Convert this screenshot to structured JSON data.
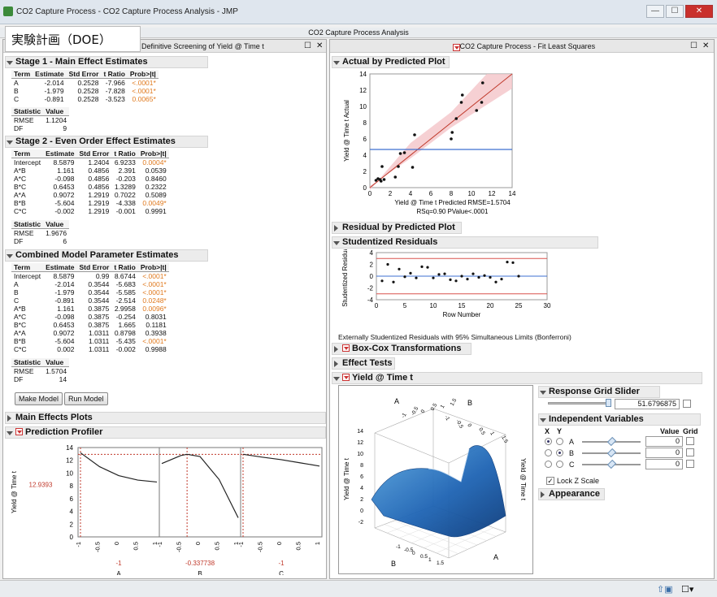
{
  "window": {
    "title": "CO2 Capture Process - CO2 Capture Process Analysis - JMP",
    "min": "—",
    "max": "☐",
    "close": "✕"
  },
  "overlay_label": "実験計画（DOE）",
  "report_title": "CO2 Capture Process Analysis",
  "left_tab": "Definitive Screening of Yield @ Time t",
  "right_tab": "CO2 Capture Process - Fit Least Squares",
  "stage1": {
    "title": "Stage 1 - Main Effect Estimates",
    "cols": [
      "Term",
      "Estimate",
      "Std Error",
      "t Ratio",
      "Prob>|t|"
    ],
    "rows": [
      [
        "A",
        "-2.014",
        "0.2528",
        "-7.966",
        "<.0001*"
      ],
      [
        "B",
        "-1.979",
        "0.2528",
        "-7.828",
        "<.0001*"
      ],
      [
        "C",
        "-0.891",
        "0.2528",
        "-3.523",
        "0.0065*"
      ]
    ],
    "stat_cols": [
      "Statistic",
      "Value"
    ],
    "stats": [
      [
        "RMSE",
        "1.1204"
      ],
      [
        "DF",
        "9"
      ]
    ]
  },
  "stage2": {
    "title": "Stage 2 - Even Order Effect Estimates",
    "cols": [
      "Term",
      "Estimate",
      "Std Error",
      "t Ratio",
      "Prob>|t|"
    ],
    "rows": [
      [
        "Intercept",
        "8.5879",
        "1.2404",
        "6.9233",
        "0.0004*"
      ],
      [
        "A*B",
        "1.161",
        "0.4856",
        "2.391",
        "0.0539"
      ],
      [
        "A*C",
        "-0.098",
        "0.4856",
        "-0.203",
        "0.8460"
      ],
      [
        "B*C",
        "0.6453",
        "0.4856",
        "1.3289",
        "0.2322"
      ],
      [
        "A*A",
        "0.9072",
        "1.2919",
        "0.7022",
        "0.5089"
      ],
      [
        "B*B",
        "-5.604",
        "1.2919",
        "-4.338",
        "0.0049*"
      ],
      [
        "C*C",
        "-0.002",
        "1.2919",
        "-0.001",
        "0.9991"
      ]
    ],
    "stat_cols": [
      "Statistic",
      "Value"
    ],
    "stats": [
      [
        "RMSE",
        "1.9676"
      ],
      [
        "DF",
        "6"
      ]
    ]
  },
  "combined": {
    "title": "Combined Model Parameter Estimates",
    "cols": [
      "Term",
      "Estimate",
      "Std Error",
      "t Ratio",
      "Prob>|t|"
    ],
    "rows": [
      [
        "Intercept",
        "8.5879",
        "0.99",
        "8.6744",
        "<.0001*"
      ],
      [
        "A",
        "-2.014",
        "0.3544",
        "-5.683",
        "<.0001*"
      ],
      [
        "B",
        "-1.979",
        "0.3544",
        "-5.585",
        "<.0001*"
      ],
      [
        "C",
        "-0.891",
        "0.3544",
        "-2.514",
        "0.0248*"
      ],
      [
        "A*B",
        "1.161",
        "0.3875",
        "2.9958",
        "0.0096*"
      ],
      [
        "A*C",
        "-0.098",
        "0.3875",
        "-0.254",
        "0.8031"
      ],
      [
        "B*C",
        "0.6453",
        "0.3875",
        "1.665",
        "0.1181"
      ],
      [
        "A*A",
        "0.9072",
        "1.0311",
        "0.8798",
        "0.3938"
      ],
      [
        "B*B",
        "-5.604",
        "1.0311",
        "-5.435",
        "<.0001*"
      ],
      [
        "C*C",
        "0.002",
        "1.0311",
        "-0.002",
        "0.9988"
      ]
    ],
    "stat_cols": [
      "Statistic",
      "Value"
    ],
    "stats": [
      [
        "RMSE",
        "1.5704"
      ],
      [
        "DF",
        "14"
      ]
    ]
  },
  "buttons": {
    "make_model": "Make Model",
    "run_model": "Run Model"
  },
  "main_effects_title": "Main Effects Plots",
  "profiler": {
    "title": "Prediction Profiler",
    "ylabel": "Yield @ Time t",
    "current_y": "12.9393",
    "yticks": [
      "14",
      "12",
      "10",
      "8",
      "6",
      "4",
      "2",
      "0"
    ],
    "xticks": [
      "-1",
      "-0.5",
      "0",
      "0.5",
      "1"
    ],
    "factors": [
      {
        "name": "A",
        "value": "-1",
        "level": -1
      },
      {
        "name": "B",
        "value": "-0.337738",
        "level": -0.337738
      },
      {
        "name": "C",
        "value": "-1",
        "level": -1
      }
    ],
    "curves": {
      "A": [
        [
          -1,
          13.18
        ],
        [
          -0.5,
          11.0
        ],
        [
          0,
          9.6
        ],
        [
          0.5,
          8.9
        ],
        [
          1,
          8.6
        ]
      ],
      "B": [
        [
          -1,
          11.5
        ],
        [
          -0.5,
          12.75
        ],
        [
          -0.337738,
          12.94
        ],
        [
          0,
          12.6
        ],
        [
          0.5,
          9.0
        ],
        [
          1,
          3.0
        ]
      ],
      "C": [
        [
          -1,
          12.94
        ],
        [
          -0.5,
          12.5
        ],
        [
          0,
          12.1
        ],
        [
          0.5,
          11.6
        ],
        [
          1,
          11.1
        ]
      ]
    }
  },
  "avp": {
    "title": "Actual by Predicted Plot",
    "ylabel": "Yield @ Time t Actual",
    "xlabel": "Yield @ Time t Predicted RMSE=1.5704",
    "stats": "RSq=0.90 PValue<.0001",
    "ticks": [
      "0",
      "2",
      "4",
      "6",
      "8",
      "10",
      "12",
      "14"
    ],
    "mean_y": 4.7,
    "chart_data": {
      "type": "scatter",
      "xlim": [
        0,
        14
      ],
      "ylim": [
        0,
        14
      ],
      "points": [
        [
          0.6,
          0.9
        ],
        [
          0.8,
          1.1
        ],
        [
          1.0,
          1.0
        ],
        [
          1.1,
          0.8
        ],
        [
          1.2,
          2.6
        ],
        [
          1.4,
          1.0
        ],
        [
          2.5,
          1.3
        ],
        [
          2.8,
          2.6
        ],
        [
          3.0,
          4.2
        ],
        [
          3.4,
          4.3
        ],
        [
          4.2,
          2.5
        ],
        [
          4.4,
          6.5
        ],
        [
          8.0,
          6.0
        ],
        [
          8.1,
          6.8
        ],
        [
          8.5,
          8.5
        ],
        [
          9.0,
          10.5
        ],
        [
          9.1,
          11.4
        ],
        [
          10.5,
          9.5
        ],
        [
          11.0,
          10.5
        ],
        [
          11.1,
          12.9
        ]
      ]
    }
  },
  "residual_pred_title": "Residual by Predicted Plot",
  "stud": {
    "title": "Studentized Residuals",
    "ylabel": "Studentized Residual",
    "xlabel": "Row Number",
    "yticks": [
      "4",
      "2",
      "0",
      "-2",
      "-4"
    ],
    "xticks": [
      "0",
      "5",
      "10",
      "15",
      "20",
      "25",
      "30"
    ],
    "note": "Externally Studentized Residuals with 95% Simultaneous Limits (Bonferroni)",
    "chart_data": {
      "type": "scatter",
      "xlim": [
        0,
        30
      ],
      "ylim": [
        -4,
        4
      ],
      "limit": 3.0,
      "points": [
        [
          1,
          -0.8
        ],
        [
          2,
          2.0
        ],
        [
          3,
          -1.0
        ],
        [
          4,
          1.2
        ],
        [
          5,
          -0.1
        ],
        [
          6,
          0.5
        ],
        [
          7,
          -0.3
        ],
        [
          8,
          1.6
        ],
        [
          9,
          1.5
        ],
        [
          10,
          -0.3
        ],
        [
          11,
          0.3
        ],
        [
          12,
          0.4
        ],
        [
          13,
          -0.6
        ],
        [
          14,
          -0.8
        ],
        [
          15,
          0.0
        ],
        [
          16,
          -0.5
        ],
        [
          17,
          0.4
        ],
        [
          18,
          -0.2
        ],
        [
          19,
          0.1
        ],
        [
          20,
          -0.2
        ],
        [
          21,
          -1.0
        ],
        [
          22,
          -0.5
        ],
        [
          23,
          2.4
        ],
        [
          24,
          2.3
        ],
        [
          25,
          0.0
        ]
      ]
    }
  },
  "boxcox_title": "Box-Cox Transformations",
  "effect_tests_title": "Effect Tests",
  "yield_title": "Yield @ Time t",
  "surface": {
    "zlabel": "Yield @ Time t",
    "axis_a": "A",
    "axis_b": "B",
    "ticks": [
      "14",
      "12",
      "10",
      "8",
      "6",
      "4",
      "2",
      "0",
      "-2"
    ],
    "xticks": [
      "-1",
      "-0.5",
      "0",
      "0.5",
      "1",
      "1.5"
    ]
  },
  "grid_slider": {
    "title": "Response Grid Slider",
    "value": "51.6796875"
  },
  "indep": {
    "title": "Independent Variables",
    "col_x": "X",
    "col_y": "Y",
    "col_value": "Value",
    "col_grid": "Grid",
    "vars": [
      {
        "name": "A",
        "value": "0"
      },
      {
        "name": "B",
        "value": "0"
      },
      {
        "name": "C",
        "value": "0"
      }
    ]
  },
  "lock_z": "Lock Z Scale",
  "appearance": "Appearance"
}
